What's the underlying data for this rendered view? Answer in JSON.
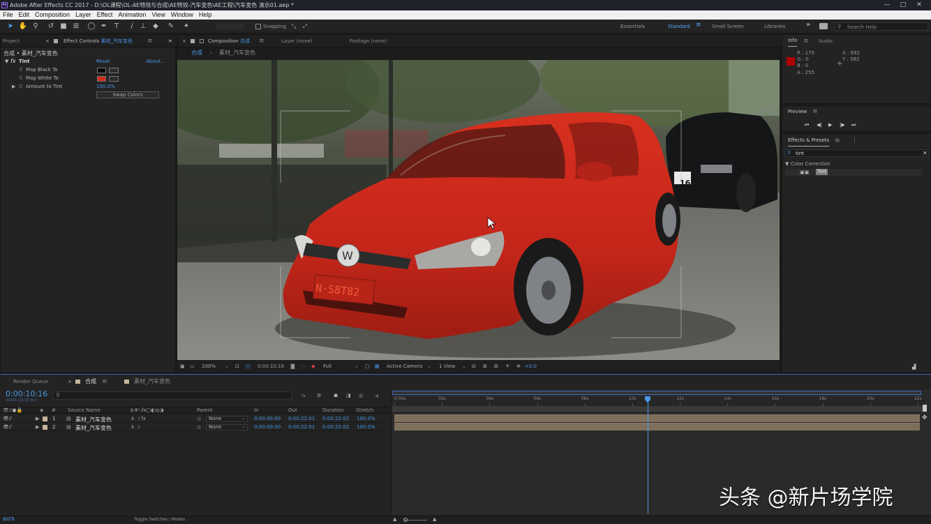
{
  "title_bar": {
    "text": "Adobe After Effects CC 2017 - D:\\OL课程\\OL-AE特效与合成\\AE特效-汽车变色\\AE工程\\汽车变色 演示01.aep *",
    "icon": "Ae",
    "minimize": "—",
    "maximize": "□",
    "close": "✕"
  },
  "menu": [
    "File",
    "Edit",
    "Composition",
    "Layer",
    "Effect",
    "Animation",
    "View",
    "Window",
    "Help"
  ],
  "toolbar": {
    "snapping": "Snapping",
    "workspaces": [
      "Essentials",
      "Standard",
      "Small Screen",
      "Libraries"
    ],
    "active_workspace": "Standard",
    "more": "»",
    "search_help": "Search Help"
  },
  "project_panel": {
    "tab_project": "Project",
    "tab_effect_controls": "Effect Controls",
    "ec_layer": "素材_汽车变色",
    "breadcrumb": "合成 • 素材_汽车变色"
  },
  "effect": {
    "name": "Tint",
    "fx": "fx",
    "reset": "Reset",
    "about": "About...",
    "props": [
      {
        "name": "Map Black To",
        "color": "#000000"
      },
      {
        "name": "Map White To",
        "color": "#d32a1a"
      }
    ],
    "amount_label": "Amount to Tint",
    "amount_value": "100.0%",
    "swap_button": "Swap Colors"
  },
  "comp_panel": {
    "tab_label": "Composition",
    "comp_name": "合成",
    "layer_tab": "Layer (none)",
    "footage_tab": "Footage (none)",
    "crumb_comp": "合成",
    "crumb_layer": "素材_汽车变色"
  },
  "viewer": {
    "license_plate": "N·S8T82",
    "plate_bg": "16"
  },
  "viewer_bar": {
    "zoom": "200%",
    "timecode": "0:00:10:16",
    "resolution": "Full",
    "camera": "Active Camera",
    "view": "1 View",
    "exposure": "+0.0"
  },
  "info": {
    "tab_info": "Info",
    "tab_audio": "Audio",
    "r": "R : 175",
    "g": "G : 0",
    "b": "B : 0",
    "a": "A : 255",
    "x": "X : 692",
    "y": "Y : 582",
    "swatch": "#af0000"
  },
  "preview": {
    "label": "Preview"
  },
  "effects_presets": {
    "label": "Effects & Presets",
    "search": "tint",
    "category": "Color Correction",
    "result": "Tint"
  },
  "timeline": {
    "tab_render_queue": "Render Queue",
    "tab_comp": "合成",
    "tab_footage": "素材_汽车变色",
    "timecode": "0:00:10:16",
    "fps": "00266 (25.00 fps)",
    "columns": {
      "num": "#",
      "source": "Source Name",
      "parent": "Parent",
      "in": "In",
      "out": "Out",
      "duration": "Duration",
      "stretch": "Stretch"
    },
    "layers": [
      {
        "num": "1",
        "name": "素材_汽车变色",
        "parent": "None",
        "in": "0:00:00:00",
        "out": "0:00:22:01",
        "duration": "0:00:22:02",
        "stretch": "100.0%",
        "has_fx": true
      },
      {
        "num": "2",
        "name": "素材_汽车变色",
        "parent": "None",
        "in": "0:00:00:00",
        "out": "0:00:22:01",
        "duration": "0:00:22:02",
        "stretch": "100.0%",
        "has_fx": false
      }
    ],
    "ruler": [
      "0:00s",
      "02s",
      "04s",
      "06s",
      "08s",
      "10s",
      "12s",
      "14s",
      "16s",
      "18s",
      "20s",
      "22s"
    ],
    "playhead_fraction": 0.484,
    "toggle_label": "Toggle Switches / Modes"
  },
  "watermark": "头条 @新片场学院",
  "colors": {
    "accent": "#4a97e6",
    "tint_red": "#c8261a",
    "track": "#7d6f5c"
  }
}
